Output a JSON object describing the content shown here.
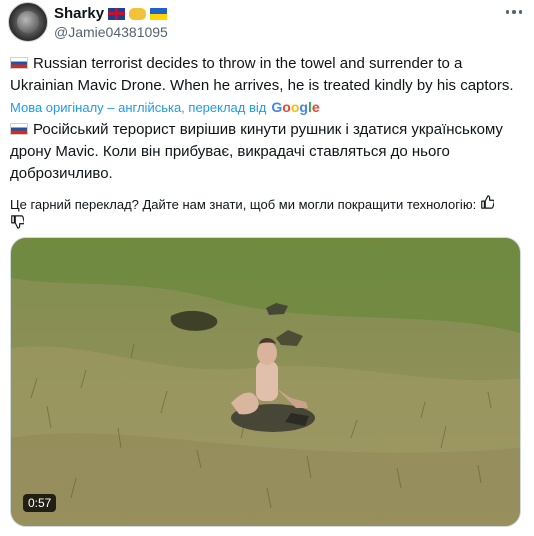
{
  "author": {
    "display_name": "Sharky",
    "handle": "@Jamie04381095",
    "name_emojis": [
      "flag-uk",
      "handshake",
      "flag-ua"
    ]
  },
  "tweet": {
    "flag_icon": "flag-russia",
    "text": "Russian terrorist decides to throw in the towel and surrender to a Ukrainian Mavic Drone. When he arrives, he is treated kindly  by his captors."
  },
  "translation": {
    "attribution": "Мова оригіналу – англійська, переклад від",
    "provider": "Google",
    "text": "Російський терорист вирішив кинути рушник і здатися українському дрону Mavic. Коли він прибуває, викрадачі ставляться до нього доброзичливо.",
    "feedback_prompt": "Це гарний переклад? Дайте нам знати, щоб ми могли покращити технологію:"
  },
  "media": {
    "duration": "0:57",
    "description_icon": "video-thumbnail"
  }
}
